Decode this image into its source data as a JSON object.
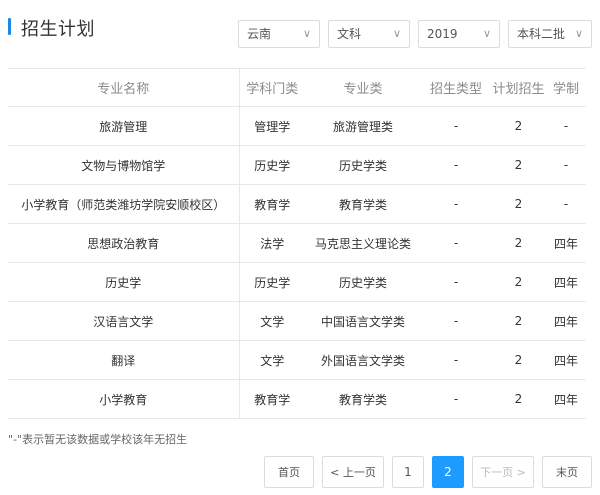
{
  "header": {
    "title": "招生计划",
    "filters": {
      "province": "云南",
      "category": "文科",
      "year": "2019",
      "batch": "本科二批"
    }
  },
  "table": {
    "columns": [
      "专业名称",
      "学科门类",
      "专业类",
      "招生类型",
      "计划招生",
      "学制"
    ],
    "rows": [
      [
        "旅游管理",
        "管理学",
        "旅游管理类",
        "-",
        "2",
        "-"
      ],
      [
        "文物与博物馆学",
        "历史学",
        "历史学类",
        "-",
        "2",
        "-"
      ],
      [
        "小学教育（师范类潍坊学院安顺校区）",
        "教育学",
        "教育学类",
        "-",
        "2",
        "-"
      ],
      [
        "思想政治教育",
        "法学",
        "马克思主义理论类",
        "-",
        "2",
        "四年"
      ],
      [
        "历史学",
        "历史学",
        "历史学类",
        "-",
        "2",
        "四年"
      ],
      [
        "汉语言文学",
        "文学",
        "中国语言文学类",
        "-",
        "2",
        "四年"
      ],
      [
        "翻译",
        "文学",
        "外国语言文学类",
        "-",
        "2",
        "四年"
      ],
      [
        "小学教育",
        "教育学",
        "教育学类",
        "-",
        "2",
        "四年"
      ]
    ]
  },
  "note": "\"-\"表示暂无该数据或学校该年无招生",
  "pagination": {
    "first": "首页",
    "prev": "< 上一页",
    "pages": [
      "1",
      "2"
    ],
    "current": "2",
    "next": "下一页 >",
    "last": "末页"
  },
  "colors": {
    "accent": "#1e88e5",
    "active_page": "#1e9bff"
  },
  "icons": {
    "dropdown": "chevron-down-icon"
  }
}
